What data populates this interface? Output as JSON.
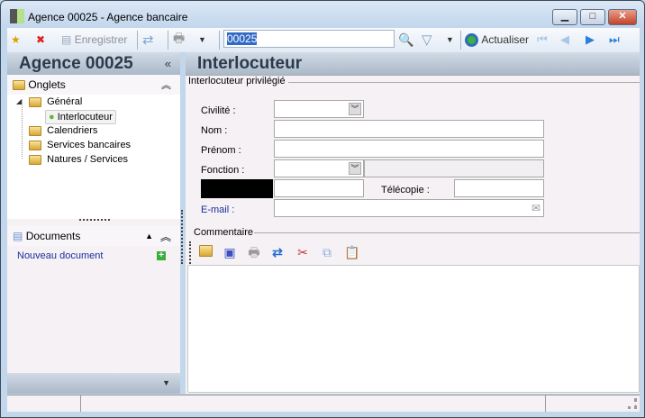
{
  "window": {
    "title": "Agence 00025 -  Agence bancaire",
    "minimize": "▁",
    "maximize": "□",
    "close": "✕"
  },
  "toolbar": {
    "save_label": "Enregistrer",
    "search_value": "00025",
    "refresh_label": "Actualiser"
  },
  "left": {
    "title": "Agence 00025",
    "collapse": "«",
    "onglets_label": "Onglets",
    "tree": [
      {
        "label": "Général",
        "children": [
          {
            "label": "Interlocuteur"
          }
        ]
      },
      {
        "label": "Calendriers"
      },
      {
        "label": "Services bancaires"
      },
      {
        "label": "Natures / Services"
      }
    ],
    "documents_label": "Documents",
    "new_document": "Nouveau document"
  },
  "main": {
    "title": "Interlocuteur",
    "group_label": "Interlocuteur privilégié",
    "fields": {
      "civilite": "Civilité :",
      "nom": "Nom :",
      "prenom": "Prénom :",
      "fonction": "Fonction :",
      "telecopie": "Télécopie :",
      "email": "E-mail :"
    },
    "comment_label": "Commentaire"
  },
  "colors": {
    "link": "#1a2e9c",
    "panel": "#f5f1f5"
  }
}
